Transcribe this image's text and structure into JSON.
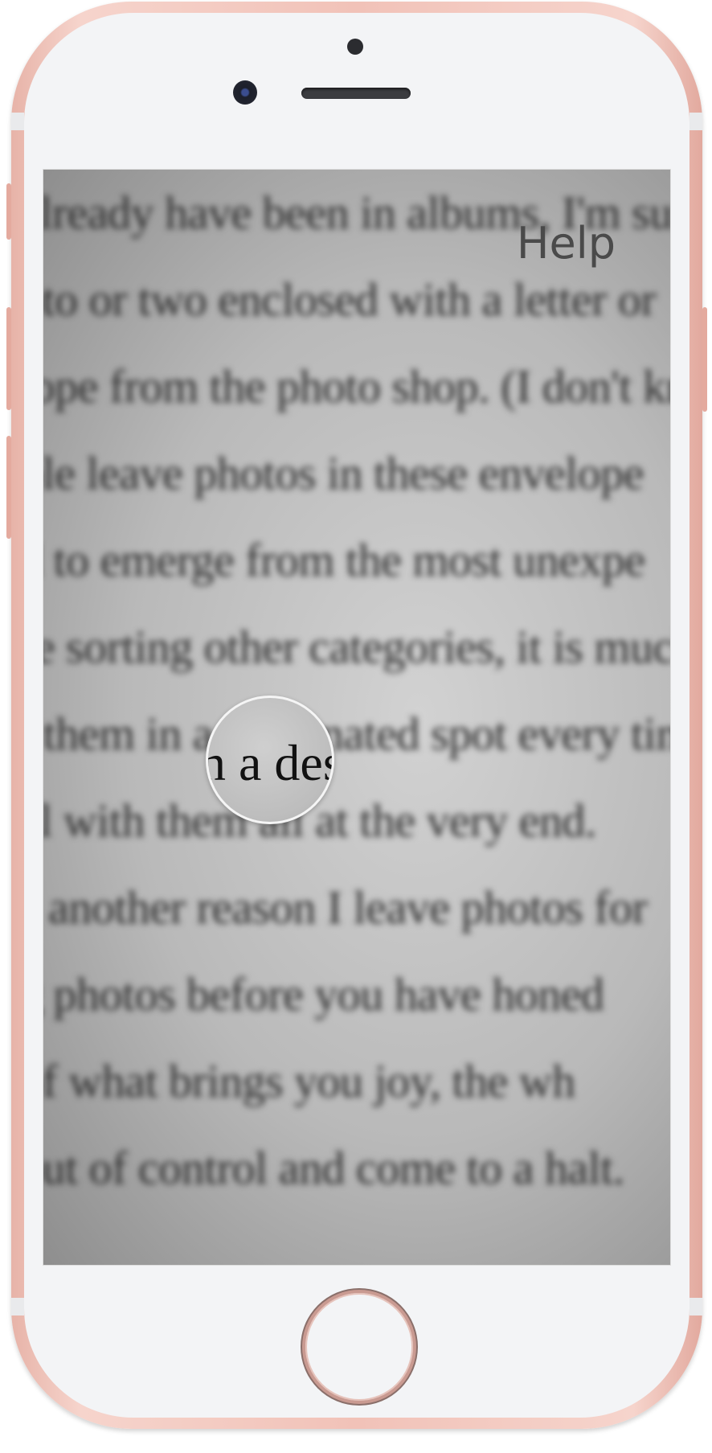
{
  "screen": {
    "help_label": "Help",
    "magnifier_text": "n a desig",
    "page_text_lines": [
      "already have been in albums, I'm sure",
      "oto or two enclosed with a letter or",
      "lope from the photo shop. (I don't kn",
      "ple leave photos in these envelope",
      "d to emerge from the most unexpe",
      "re sorting other categories, it is much",
      "t them in a designated spot every tim",
      "al with them all at the very end.",
      "s another reason I leave photos for",
      "g photos before you have honed",
      "of what brings you joy, the wh",
      "out of control and come to a halt."
    ]
  },
  "icons": {
    "front_camera": "front-camera-icon",
    "proximity_sensor": "sensor-icon",
    "earpiece": "speaker-icon",
    "home": "home-button-icon"
  },
  "colors": {
    "frame": "#f1c2b8",
    "face": "#f3f4f6",
    "help_text": "#4a4a4a"
  }
}
